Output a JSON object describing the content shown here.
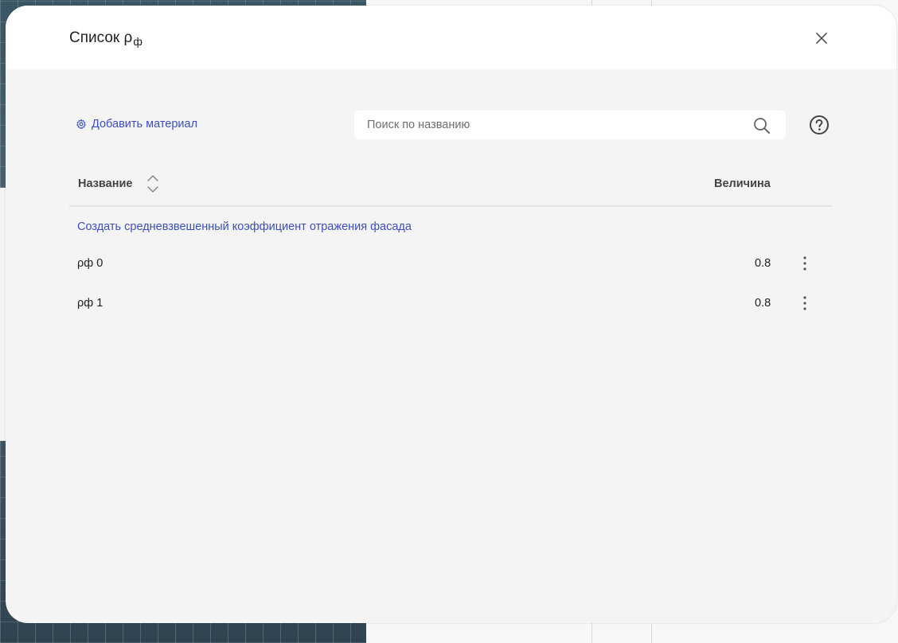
{
  "modal": {
    "title_main": "Список ρ",
    "title_sub": "ф",
    "add_material_label": "Добавить материал",
    "search_placeholder": "Поиск по названию",
    "search_value": "",
    "create_link_label": "Создать средневзвешенный коэффициент отражения фасада",
    "table": {
      "columns": [
        "Название",
        "Величина"
      ],
      "rows": [
        {
          "name": "ρф 0",
          "value": "0.8"
        },
        {
          "name": "ρф 1",
          "value": "0.8"
        }
      ]
    }
  },
  "icons": {
    "close": "close-icon",
    "add_material": "gear-icon",
    "search": "search-icon",
    "help": "help-icon",
    "sort": "sort-icon",
    "row_menu": "more-vertical-icon"
  },
  "colors": {
    "accent": "#3d4fbf",
    "modal_bg": "#f4f4f4",
    "header_bg": "#ffffff"
  }
}
